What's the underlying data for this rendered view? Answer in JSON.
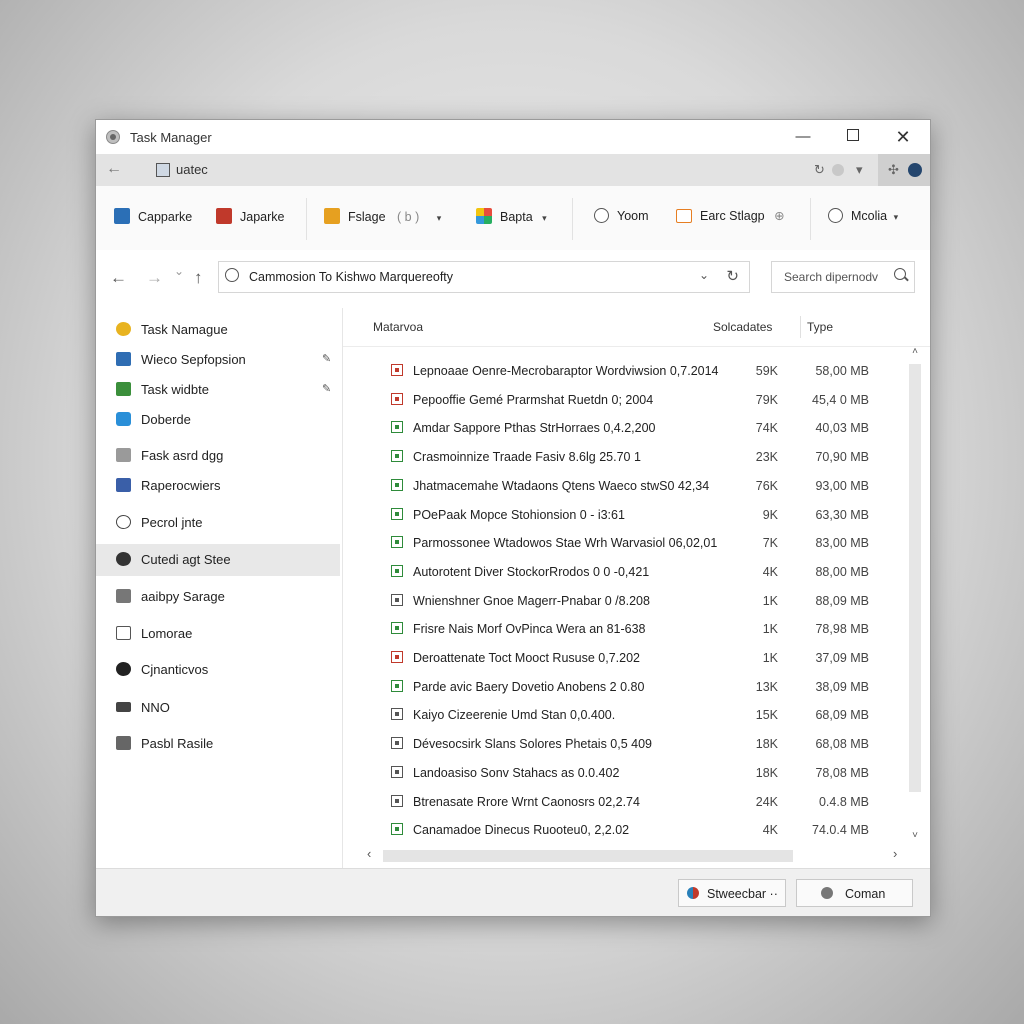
{
  "window": {
    "title": "Task Manager",
    "controls": {
      "minimize": "—",
      "close": "✕"
    }
  },
  "tabstrip": {
    "back": "←",
    "tab_label": "uatec",
    "icons": [
      "↻",
      "▾"
    ]
  },
  "ribbon": {
    "items": [
      {
        "label": "Capparke",
        "icon": "app-icon",
        "color": "#2b6fb6"
      },
      {
        "label": "Japarke",
        "icon": "tools-icon",
        "color": "#c0392b"
      },
      {
        "label": "Fslage",
        "suffix": "( b )",
        "icon": "folder-icon",
        "color": "#e6a020",
        "dropdown": true
      },
      {
        "label": "Bapta",
        "icon": "colorful-icon",
        "color": "#d35400",
        "dropdown": true
      },
      {
        "label": "Yoom",
        "icon": "circle-icon",
        "color": "#555555"
      },
      {
        "label": "Earc Stlagp",
        "suffix": "⊕",
        "icon": "storage-icon",
        "color": "#e67e22"
      },
      {
        "label": "Mcolia",
        "icon": "gear-icon",
        "color": "#555555",
        "dropdown": true
      }
    ],
    "dropdown_glyph": "▾"
  },
  "nav": {
    "back": "←",
    "forward": "→",
    "history": "⌄",
    "up": "↑",
    "address": "Cammosion To Kishwo Marquereofty",
    "address_chevron": "⌄",
    "refresh": "↻",
    "search_placeholder": "Search dipernodv"
  },
  "sidebar": {
    "pin_glyph": "📌",
    "items": [
      {
        "label": "Task Namague",
        "color": "#e8b320",
        "pinned": false
      },
      {
        "label": "Wieco Sepfopsion",
        "color": "#2f6db3",
        "pinned": true
      },
      {
        "label": "Task widbte",
        "color": "#3b8f3b",
        "pinned": true
      },
      {
        "label": "Doberde",
        "color": "#2a8fd8",
        "pinned": false
      },
      {
        "label": "Fask asrd dgg",
        "color": "#7a7a7a",
        "pinned": false
      },
      {
        "label": "Raperocwiers",
        "color": "#3a5fa8",
        "pinned": false
      },
      {
        "label": "Pecrol jnte",
        "color": "#ffffff",
        "pinned": false
      },
      {
        "label": "Cutedi agt Stee",
        "color": "#333333",
        "pinned": false,
        "active": true
      },
      {
        "label": "aaibpy Sarage",
        "color": "#555555",
        "pinned": false
      },
      {
        "label": "Lomorae",
        "color": "#666666",
        "pinned": false
      },
      {
        "label": "Cjnanticvos",
        "color": "#222222",
        "pinned": false
      },
      {
        "label": "NNO",
        "color": "#444444",
        "pinned": false
      },
      {
        "label": "Pasbl Rasile",
        "color": "#555555",
        "pinned": false
      }
    ]
  },
  "list": {
    "columns": {
      "name": "Matarvoa",
      "date": "Solcadates",
      "type": "Type"
    },
    "rows": [
      {
        "name": "Lepnoaae Oenre-Mecrobaraptor Wordviwsion 0,7.2014",
        "size": "59K",
        "type": "58,00 MB",
        "color": "#c0392b"
      },
      {
        "name": "Pepooffie Gemé Prarmshat Ruetdn 0; 2004",
        "size": "79K",
        "type": "45,4 0 MB",
        "color": "#c0392b"
      },
      {
        "name": "Amdar Sappore Pthas StrHorraes 0,4.2,200",
        "size": "74K",
        "type": "40,03 MB",
        "color": "#2e8b3a"
      },
      {
        "name": "Crasmoinnize Traade Fasiv 8.6lg 25.70 1",
        "size": "23K",
        "type": "70,90 MB",
        "color": "#2e8b3a"
      },
      {
        "name": "Jhatmacemahe Wtadaons Qtens Waeco stwS0 42,34",
        "size": "76K",
        "type": "93,00 MB",
        "color": "#2e8b3a"
      },
      {
        "name": "POePaak Mopce Stohionsion 0 - i3:61",
        "size": "9K",
        "type": "63,30 MB",
        "color": "#2e8b3a"
      },
      {
        "name": "Parmossonee Wtadowos Stae Wrh Warvasiol 06,02,01",
        "size": "7K",
        "type": "83,00 MB",
        "color": "#2e8b3a"
      },
      {
        "name": "Autorotent Diver StockorRrodos 0 0 -0,421",
        "size": "4K",
        "type": "88,00 MB",
        "color": "#2e8b3a"
      },
      {
        "name": "Wnienshner Gnoe Magerr-Pnabar 0 /8.208",
        "size": "1K",
        "type": "88,09 MB",
        "color": "#555555"
      },
      {
        "name": "Frisre Nais Morf OvPinca Wera an 81-638",
        "size": "1K",
        "type": "78,98 MB",
        "color": "#2e8b3a"
      },
      {
        "name": "Deroattenate Toct Mooct Rususe 0,7.202",
        "size": "1K",
        "type": "37,09 MB",
        "color": "#c0392b"
      },
      {
        "name": "Parde avic Baery Dovetio Anobens 2 0.80",
        "size": "13K",
        "type": "38,09 MB",
        "color": "#2e8b3a"
      },
      {
        "name": "Kaiyo Cizeerenie Umd Stan 0,0.400.",
        "size": "15K",
        "type": "68,09 MB",
        "color": "#555555"
      },
      {
        "name": "Dévesocsirk Slans Solores Phetais 0,5 409",
        "size": "18K",
        "type": "68,08 MB",
        "color": "#555555"
      },
      {
        "name": "Landoasiso Sonv Stahacs as 0.0.402",
        "size": "18K",
        "type": "78,08 MB",
        "color": "#555555"
      },
      {
        "name": "Btrenasate Rrore Wrnt Caonosrs 02,2.74",
        "size": "24K",
        "type": "0.4.8 MB",
        "color": "#555555"
      },
      {
        "name": "Canamadoe Dinecus Ruooteu0, 2,2.02",
        "size": "4K",
        "type": "74.0.4 MB",
        "color": "#2e8b3a"
      }
    ],
    "scroll": {
      "up": "˄",
      "down": "˅",
      "left": "‹",
      "right": "›"
    }
  },
  "footer": {
    "buttons": [
      {
        "label": "Stweecbar ··",
        "color": "#c0392b"
      },
      {
        "label": "Coman",
        "color": "#777777"
      }
    ]
  }
}
